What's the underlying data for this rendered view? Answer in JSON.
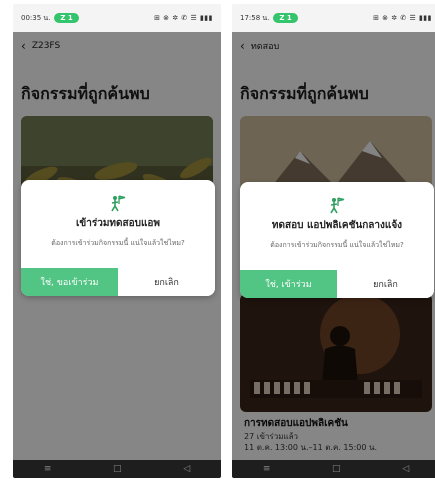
{
  "colors": {
    "accent": "#52c484",
    "status_pill": "#33c46c"
  },
  "left": {
    "status": {
      "time": "00:35 น.",
      "pill": "Z 1",
      "icons": "⊞ ⊗ ✲ ✆ ☰ ▮▮▮"
    },
    "nav": {
      "title": "Z23FS"
    },
    "heading": "กิจกรรมที่ถูกค้นพบ",
    "dialog": {
      "title": "เข้าร่วมทดสอบแอพ",
      "message": "ต้องการเข้าร่วมกิจกรรมนี้ แน่ใจแล้วใช่ไหม?",
      "confirm": "ใช่, ขอเข้าร่วม",
      "cancel": "ยกเลิก"
    }
  },
  "right": {
    "status": {
      "time": "17:58 น.",
      "pill": "Z 1",
      "icons": "⊞ ⊗ ✲ ✆ ☰ ▮▮▮"
    },
    "nav": {
      "title": "ทดสอบ"
    },
    "heading": "กิจกรรมที่ถูกค้นพบ",
    "dialog": {
      "title": "ทดสอบ แอปพลิเคชันกลางแจ้ง",
      "message": "ต้องการเข้าร่วมกิจกรรมนี้ แน่ใจแล้วใช่ไหม?",
      "confirm": "ใช่, เข้าร่วม",
      "cancel": "ยกเลิก"
    },
    "card2": {
      "title": "การทดสอบแอปพลิเคชัน",
      "line1": "27 เข้าร่วมแล้ว",
      "line2": "11 ต.ค. 13:00 น.–11 ต.ค. 15:00 น."
    }
  },
  "bottom_nav": {
    "menu": "≡",
    "home": "□",
    "back": "◁"
  }
}
